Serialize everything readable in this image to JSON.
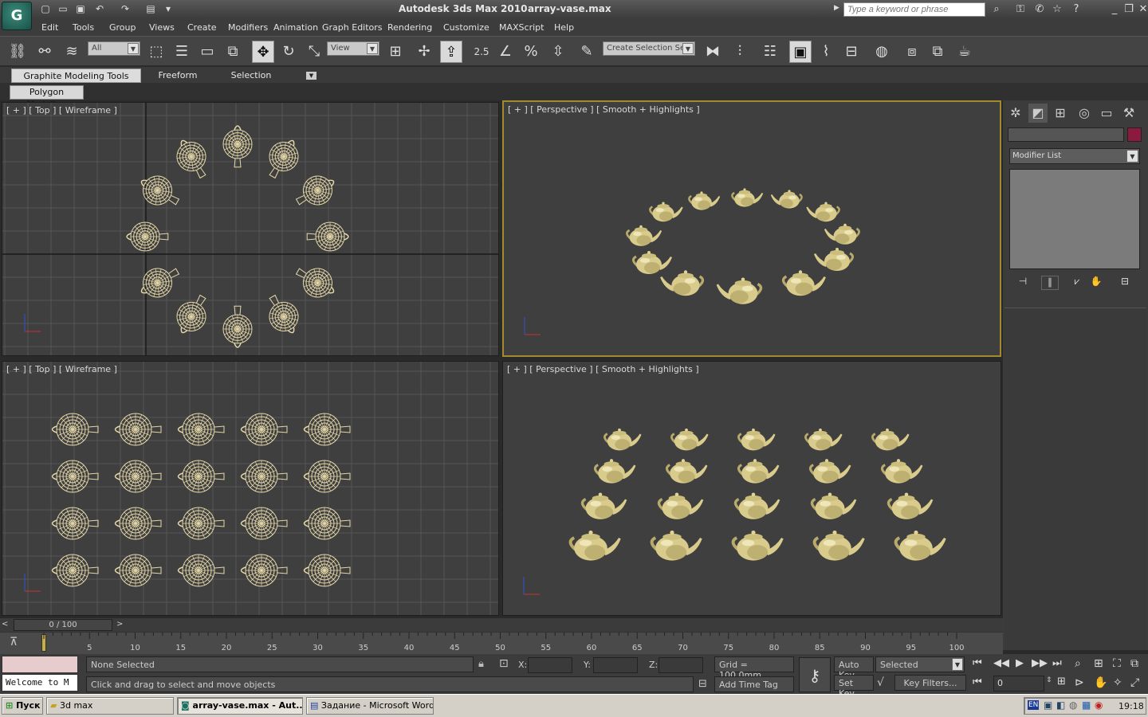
{
  "app": {
    "logo": "G",
    "title": "Autodesk 3ds Max  2010",
    "file": "array-vase.max",
    "search_placeholder": "Type a keyword or phrase"
  },
  "menu": [
    "Edit",
    "Tools",
    "Group",
    "Views",
    "Create",
    "Modifiers",
    "Animation",
    "Graph Editors",
    "Rendering",
    "Customize",
    "MAXScript",
    "Help"
  ],
  "toolbar": {
    "filter_value": "All",
    "refcoord_value": "View",
    "snap_label": "2.5",
    "selection_set_value": "Create Selection Se"
  },
  "ribbon": {
    "tabs": [
      "Graphite Modeling Tools",
      "Freeform",
      "Selection"
    ],
    "subtab": "Polygon Modeling"
  },
  "viewports": {
    "top_left": "[ + ] [ Top ] [ Wireframe ]",
    "top_right": "[ + ] [ Perspective ] [ Smooth + Highlights ]",
    "bottom_left": "[ + ] [ Top ] [ Wireframe ]",
    "bottom_right": "[ + ] [ Perspective ] [ Smooth + Highlights ]"
  },
  "command_panel": {
    "modifier_list": "Modifier List"
  },
  "timeline": {
    "slider_text": "0 / 100",
    "ticks": [
      "5",
      "10",
      "15",
      "20",
      "25",
      "30",
      "35",
      "40",
      "45",
      "50",
      "55",
      "60",
      "65",
      "70",
      "75",
      "80",
      "85",
      "90",
      "95",
      "100"
    ]
  },
  "status": {
    "selection": "None Selected",
    "prompt": "Click and drag to select and move objects",
    "x_label": "X:",
    "y_label": "Y:",
    "z_label": "Z:",
    "grid": "Grid = 100,0mm",
    "add_time_tag": "Add Time Tag",
    "auto_key": "Auto Key",
    "set_key": "Set Key",
    "selected_dropdown": "Selected",
    "key_filters": "Key Filters...",
    "frame_value": "0",
    "welcome": "Welcome to M"
  },
  "taskbar": {
    "start": "Пуск",
    "tasks": [
      "3d max",
      "array-vase.max - Aut...",
      "Задание - Microsoft Word"
    ],
    "lang": "EN",
    "clock": "19:18"
  },
  "colors": {
    "viewport_bg": "#3f3f3f",
    "grid_line": "#555555",
    "wireframe": "#e6d8a8",
    "teapot": "#d8cb8c",
    "active_border": "#a38a2c"
  }
}
